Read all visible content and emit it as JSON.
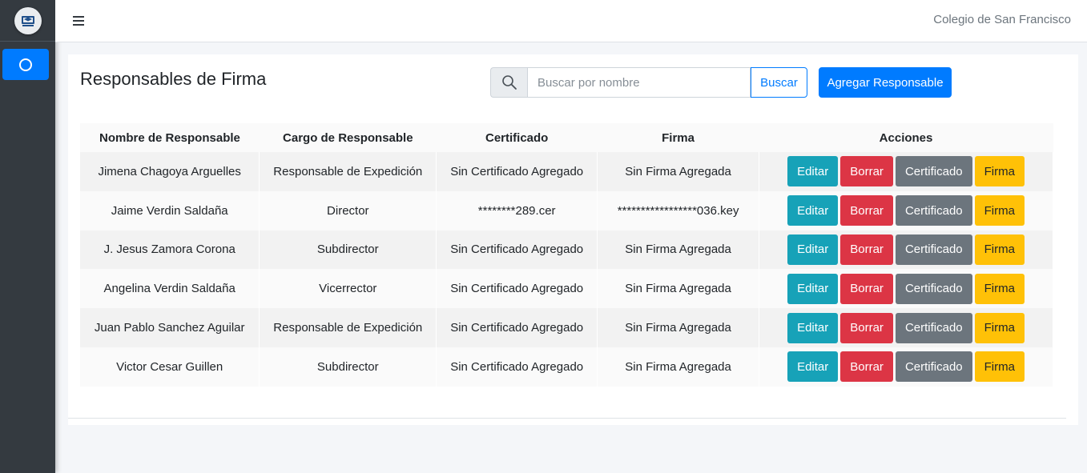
{
  "header": {
    "school_name": "Colegio de San Francisco"
  },
  "sidebar": {
    "logo_icon": "school-logo-icon",
    "active_item_icon": "circle-icon"
  },
  "page": {
    "title": "Responsables de Firma"
  },
  "search": {
    "placeholder": "Buscar por nombre",
    "value": "",
    "button_label": "Buscar"
  },
  "add_button_label": "Agregar Responsable",
  "table": {
    "headers": [
      "Nombre de Responsable",
      "Cargo de Responsable",
      "Certificado",
      "Firma",
      "Acciones"
    ],
    "action_labels": {
      "edit": "Editar",
      "delete": "Borrar",
      "certificate": "Certificado",
      "signature": "Firma"
    },
    "rows": [
      {
        "name": "Jimena Chagoya Arguelles",
        "position": "Responsable de Expedición",
        "certificate": "Sin Certificado Agregado",
        "signature": "Sin Firma Agregada"
      },
      {
        "name": "Jaime Verdin Saldaña",
        "position": "Director",
        "certificate": "********289.cer",
        "signature": "*****************036.key"
      },
      {
        "name": "J. Jesus Zamora Corona",
        "position": "Subdirector",
        "certificate": "Sin Certificado Agregado",
        "signature": "Sin Firma Agregada"
      },
      {
        "name": "Angelina Verdin Saldaña",
        "position": "Vicerrector",
        "certificate": "Sin Certificado Agregado",
        "signature": "Sin Firma Agregada"
      },
      {
        "name": "Juan Pablo Sanchez Aguilar",
        "position": "Responsable de Expedición",
        "certificate": "Sin Certificado Agregado",
        "signature": "Sin Firma Agregada"
      },
      {
        "name": "Victor Cesar Guillen",
        "position": "Subdirector",
        "certificate": "Sin Certificado Agregado",
        "signature": "Sin Firma Agregada"
      }
    ]
  },
  "colors": {
    "primary": "#007bff",
    "info": "#17a2b8",
    "danger": "#dc3545",
    "secondary": "#6c757d",
    "warning": "#ffc107",
    "sidebar": "#343a40"
  }
}
